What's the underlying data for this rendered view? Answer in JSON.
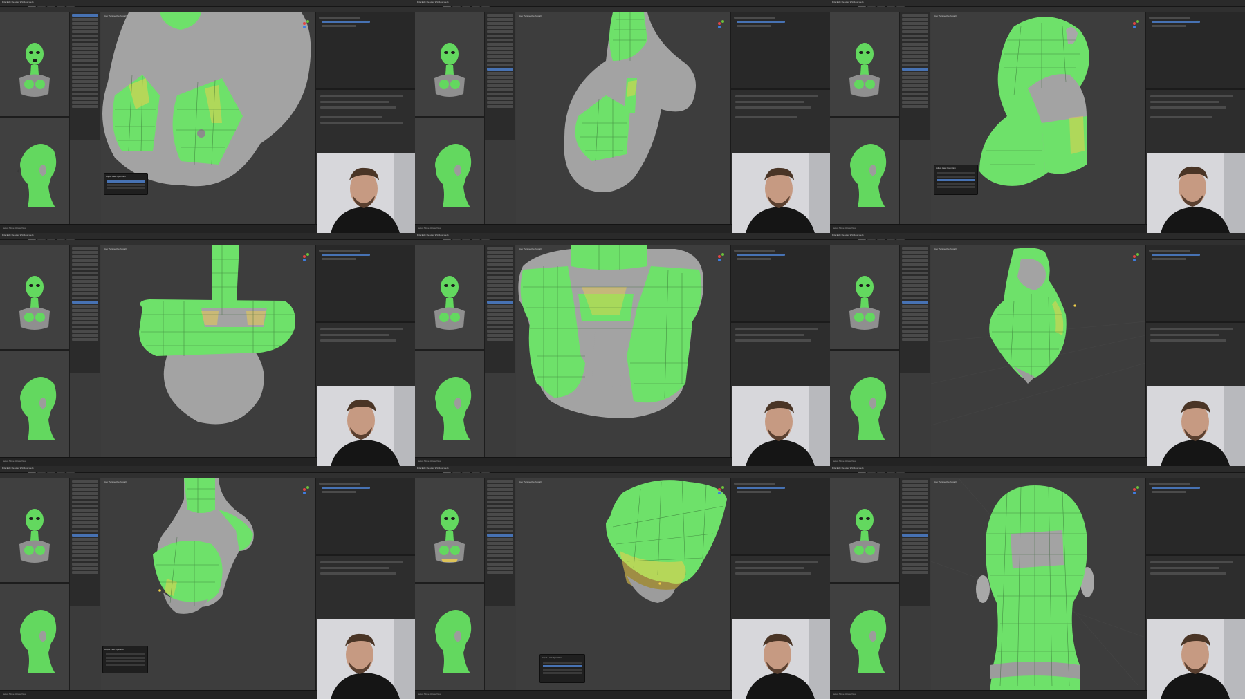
{
  "app": {
    "name": "Blender",
    "menu_text": "File Edit Render Window Help",
    "viewport_info": "User Perspective (Local)",
    "status_text": "Select  Move  Rotate View",
    "popup_title": "Adjust Last Operation"
  },
  "colors": {
    "mesh_green": "#6ee16a",
    "mesh_gray": "#9c9c9c",
    "selection_yellow": "#f0d04a",
    "ui_dark": "#2a2a2a",
    "ui_accent": "#4772b3"
  },
  "panels": [
    {
      "id": 1,
      "view": "front-chest",
      "active_tool_index": 0,
      "popup": true
    },
    {
      "id": 2,
      "view": "side-chest",
      "active_tool_index": 13,
      "popup": false
    },
    {
      "id": 3,
      "view": "head-shoulder",
      "active_tool_index": 13,
      "popup": true
    },
    {
      "id": 4,
      "view": "neck-shoulders",
      "active_tool_index": 13,
      "popup": false
    },
    {
      "id": 5,
      "view": "full-torso",
      "active_tool_index": 13,
      "popup": false
    },
    {
      "id": 6,
      "view": "side-torso",
      "active_tool_index": 13,
      "popup": false
    },
    {
      "id": 7,
      "view": "angled-torso",
      "active_tool_index": 13,
      "popup": true
    },
    {
      "id": 8,
      "view": "underside",
      "active_tool_index": 13,
      "popup": true
    },
    {
      "id": 9,
      "view": "back-head",
      "active_tool_index": 13,
      "popup": false
    }
  ]
}
